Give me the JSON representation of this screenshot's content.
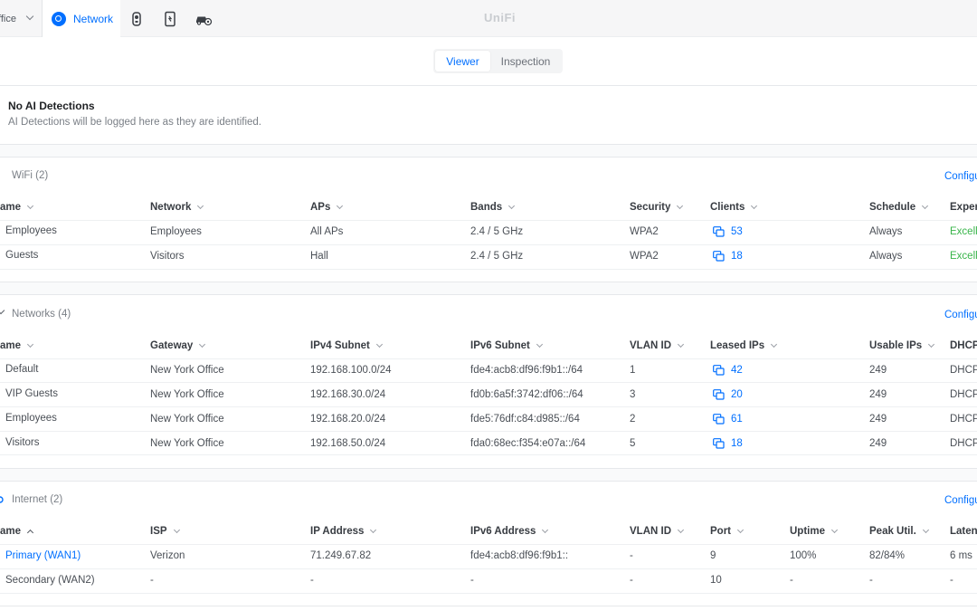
{
  "topbar": {
    "site_label": "ffice",
    "network_tab_label": "Network",
    "logo_text": "UniFi",
    "app_icons": [
      "protect-camera-icon",
      "access-door-icon",
      "vehicle-gear-icon"
    ]
  },
  "view_toggle": {
    "viewer": "Viewer",
    "inspection": "Inspection"
  },
  "ai": {
    "title": "No AI Detections",
    "subtitle": "AI Detections will be logged here as they are identified."
  },
  "wifi": {
    "title": "WiFi (2)",
    "configure": "Configure",
    "columns": [
      "ame",
      "Network",
      "APs",
      "Bands",
      "Security",
      "Clients",
      "Schedule",
      "Exper"
    ],
    "rows": [
      {
        "name": "Employees",
        "network": "Employees",
        "aps": "All APs",
        "bands": "2.4 / 5 GHz",
        "security": "WPA2",
        "clients": "53",
        "schedule": "Always",
        "experience": "Excell"
      },
      {
        "name": "Guests",
        "network": "Visitors",
        "aps": "Hall",
        "bands": "2.4 / 5 GHz",
        "security": "WPA2",
        "clients": "18",
        "schedule": "Always",
        "experience": "Excell"
      }
    ]
  },
  "networks": {
    "title": "Networks (4)",
    "configure": "Configu",
    "columns": [
      "ame",
      "Gateway",
      "IPv4 Subnet",
      "IPv6 Subnet",
      "VLAN ID",
      "Leased IPs",
      "Usable IPs",
      "DHCP"
    ],
    "rows": [
      {
        "name": "Default",
        "gateway": "New York Office",
        "ipv4": "192.168.100.0/24",
        "ipv6": "fde4:acb8:df96:f9b1::/64",
        "vlan": "1",
        "leased": "42",
        "usable": "249",
        "dhcp": "DHCP"
      },
      {
        "name": "VIP Guests",
        "gateway": "New York Office",
        "ipv4": "192.168.30.0/24",
        "ipv6": "fd0b:6a5f:3742:df06::/64",
        "vlan": "3",
        "leased": "20",
        "usable": "249",
        "dhcp": "DHCP"
      },
      {
        "name": "Employees",
        "gateway": "New York Office",
        "ipv4": "192.168.20.0/24",
        "ipv6": "fde5:76df:c84:d985::/64",
        "vlan": "2",
        "leased": "61",
        "usable": "249",
        "dhcp": "DHCP"
      },
      {
        "name": "Visitors",
        "gateway": "New York Office",
        "ipv4": "192.168.50.0/24",
        "ipv6": "fda0:68ec:f354:e07a::/64",
        "vlan": "5",
        "leased": "18",
        "usable": "249",
        "dhcp": "DHCP"
      }
    ]
  },
  "internet": {
    "title": "Internet (2)",
    "configure": "Configu",
    "columns": [
      "ame",
      "ISP",
      "IP Address",
      "IPv6 Address",
      "VLAN ID",
      "Port",
      "Uptime",
      "Peak Util.",
      "Laten"
    ],
    "rows": [
      {
        "name": "Primary (WAN1)",
        "isp": "Verizon",
        "ip": "71.249.67.82",
        "ipv6": "fde4:acb8:df96:f9b1::",
        "vlan": "-",
        "port": "9",
        "uptime": "100%",
        "peak": "82/84%",
        "latency": "6 ms"
      },
      {
        "name": "Secondary (WAN2)",
        "isp": "-",
        "ip": "-",
        "ipv6": "-",
        "vlan": "-",
        "port": "10",
        "uptime": "-",
        "peak": "-",
        "latency": "-"
      }
    ]
  },
  "colors": {
    "accent": "#006fff",
    "success": "#39b54a",
    "muted": "#7a7f86"
  }
}
